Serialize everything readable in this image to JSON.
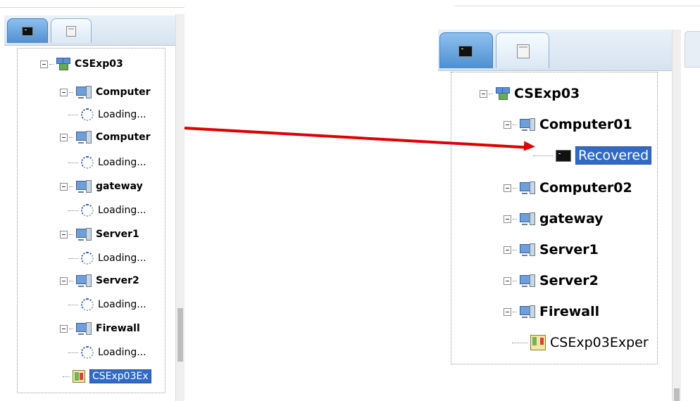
{
  "left_panel": {
    "tree": [
      {
        "label": "CSExp03",
        "icon": "network-icon",
        "kind": "root"
      },
      {
        "label": "Computer",
        "icon": "computer-icon",
        "kind": "node"
      },
      {
        "label": "Loading...",
        "icon": "loading-spinner-icon",
        "kind": "leaf"
      },
      {
        "label": "Computer",
        "icon": "computer-icon",
        "kind": "node"
      },
      {
        "label": "Loading...",
        "icon": "loading-spinner-icon",
        "kind": "leaf"
      },
      {
        "label": "gateway",
        "icon": "computer-icon",
        "kind": "node"
      },
      {
        "label": "Loading...",
        "icon": "loading-spinner-icon",
        "kind": "leaf"
      },
      {
        "label": "Server1",
        "icon": "computer-icon",
        "kind": "node"
      },
      {
        "label": "Loading...",
        "icon": "loading-spinner-icon",
        "kind": "leaf"
      },
      {
        "label": "Server2",
        "icon": "computer-icon",
        "kind": "node"
      },
      {
        "label": "Loading...",
        "icon": "loading-spinner-icon",
        "kind": "leaf"
      },
      {
        "label": "Firewall",
        "icon": "computer-icon",
        "kind": "node"
      },
      {
        "label": "Loading...",
        "icon": "loading-spinner-icon",
        "kind": "leaf"
      },
      {
        "label": "CSExp03Ex",
        "icon": "map-icon",
        "kind": "leaf-selected"
      }
    ]
  },
  "right_panel": {
    "tree": [
      {
        "label": "CSExp03",
        "icon": "network-icon",
        "kind": "root"
      },
      {
        "label": "Computer01",
        "icon": "computer-icon",
        "kind": "node"
      },
      {
        "label": "Recovered",
        "icon": "terminal-icon",
        "kind": "leaf-selected"
      },
      {
        "label": "Computer02",
        "icon": "computer-icon",
        "kind": "node"
      },
      {
        "label": "gateway",
        "icon": "computer-icon",
        "kind": "node"
      },
      {
        "label": "Server1",
        "icon": "computer-icon",
        "kind": "node"
      },
      {
        "label": "Server2",
        "icon": "computer-icon",
        "kind": "node"
      },
      {
        "label": "Firewall",
        "icon": "computer-icon",
        "kind": "node"
      },
      {
        "label": "CSExp03Exper",
        "icon": "map-icon",
        "kind": "leaf"
      }
    ]
  },
  "colors": {
    "arrow": "#e00000",
    "selection": "#316ac5",
    "tab_active": "#4f8fd0"
  }
}
